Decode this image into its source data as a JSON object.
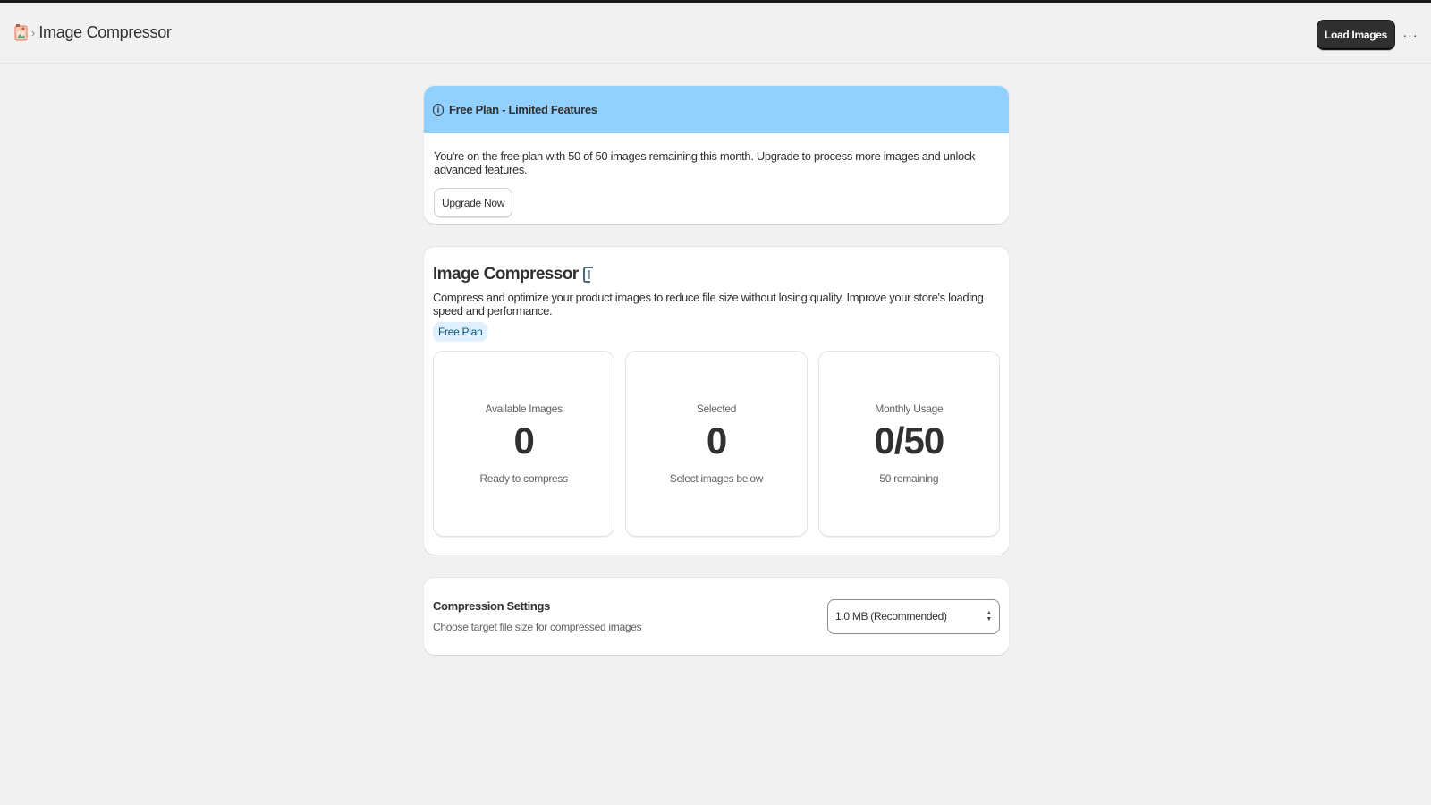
{
  "header": {
    "app_icon": "image-compressor-app-icon",
    "breadcrumb_separator": "›",
    "title": "Image Compressor",
    "load_button": "Load Images",
    "more_label": "···"
  },
  "banner": {
    "icon": "info-icon",
    "icon_glyph": "i",
    "title": "Free Plan - Limited Features",
    "text": "You're on the free plan with 50 of 50 images remaining this month. Upgrade to process more images and unlock advanced features.",
    "upgrade_button": "Upgrade Now",
    "header_color": "#91d0ff"
  },
  "main": {
    "title": "Image Compressor",
    "title_icon": "clamp-icon",
    "description": "Compress and optimize your product images to reduce file size without losing quality. Improve your store's loading speed and performance.",
    "plan_badge": "Free Plan",
    "stats": [
      {
        "label": "Available Images",
        "value": "0",
        "sub": "Ready to compress"
      },
      {
        "label": "Selected",
        "value": "0",
        "sub": "Select images below"
      },
      {
        "label": "Monthly Usage",
        "value": "0/50",
        "sub": "50 remaining"
      }
    ]
  },
  "settings": {
    "title": "Compression Settings",
    "subtitle": "Choose target file size for compressed images",
    "selected_option": "1.0 MB (Recommended)",
    "select_icon": "select-updown-icon"
  }
}
